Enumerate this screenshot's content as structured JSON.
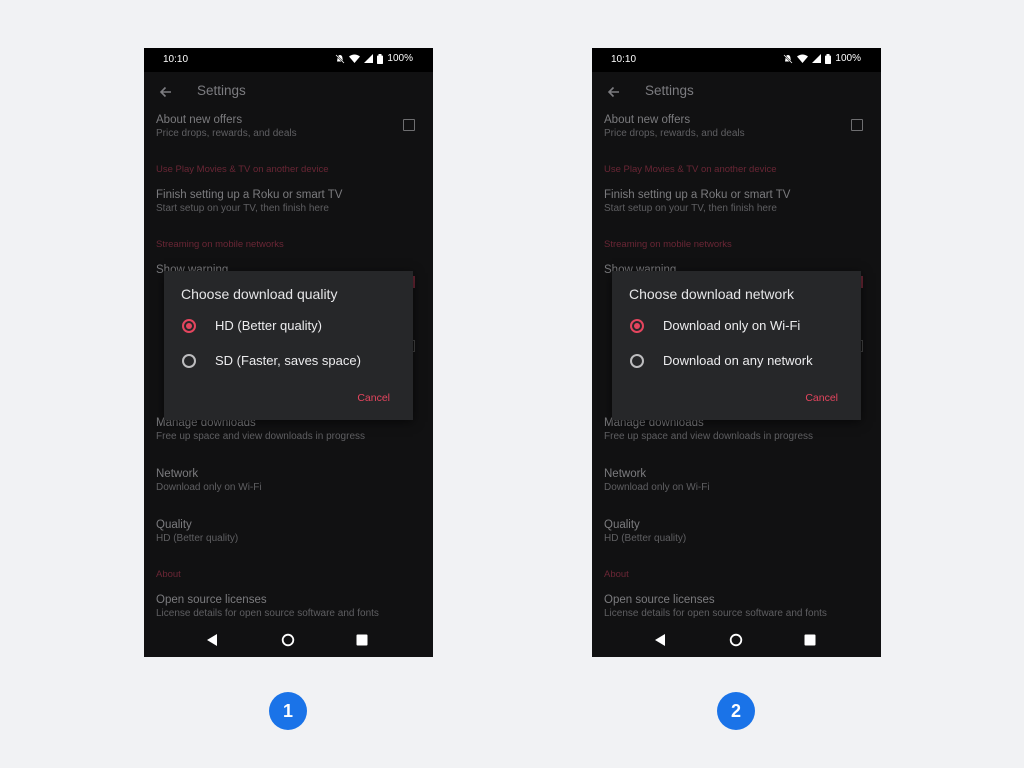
{
  "accent_color": "#e4455e",
  "badge_color": "#1a73e8",
  "screens": [
    {
      "status": {
        "time": "10:10",
        "battery": "100%"
      },
      "header": {
        "title": "Settings",
        "back_icon": "arrow-back-icon"
      },
      "settings": {
        "offers": {
          "title": "About new offers",
          "subtitle": "Price drops, rewards, and deals"
        },
        "section_device": "Use Play Movies & TV on another device",
        "roku": {
          "title": "Finish setting up a Roku or smart TV",
          "subtitle": "Start setup on your TV, then finish here"
        },
        "section_streaming": "Streaming on mobile networks",
        "show_warning": {
          "title": "Show warning"
        },
        "manage": {
          "title": "Manage downloads",
          "subtitle": "Free up space and view downloads in progress"
        },
        "network": {
          "title": "Network",
          "subtitle": "Download only on Wi-Fi"
        },
        "quality": {
          "title": "Quality",
          "subtitle": "HD (Better quality)"
        },
        "section_about": "About",
        "licenses": {
          "title": "Open source licenses",
          "subtitle": "License details for open source software and fonts"
        }
      },
      "dialog": {
        "title": "Choose download quality",
        "options": [
          {
            "label": "HD (Better quality)",
            "selected": true
          },
          {
            "label": "SD (Faster, saves space)",
            "selected": false
          }
        ],
        "cancel": "Cancel"
      },
      "badge": "1"
    },
    {
      "status": {
        "time": "10:10",
        "battery": "100%"
      },
      "header": {
        "title": "Settings",
        "back_icon": "arrow-back-icon"
      },
      "settings": {
        "offers": {
          "title": "About new offers",
          "subtitle": "Price drops, rewards, and deals"
        },
        "section_device": "Use Play Movies & TV on another device",
        "roku": {
          "title": "Finish setting up a Roku or smart TV",
          "subtitle": "Start setup on your TV, then finish here"
        },
        "section_streaming": "Streaming on mobile networks",
        "show_warning": {
          "title": "Show warning"
        },
        "manage": {
          "title": "Manage downloads",
          "subtitle": "Free up space and view downloads in progress"
        },
        "network": {
          "title": "Network",
          "subtitle": "Download only on Wi-Fi"
        },
        "quality": {
          "title": "Quality",
          "subtitle": "HD (Better quality)"
        },
        "section_about": "About",
        "licenses": {
          "title": "Open source licenses",
          "subtitle": "License details for open source software and fonts"
        }
      },
      "dialog": {
        "title": "Choose download network",
        "options": [
          {
            "label": "Download only on Wi-Fi",
            "selected": true
          },
          {
            "label": "Download on any network",
            "selected": false
          }
        ],
        "cancel": "Cancel"
      },
      "badge": "2"
    }
  ]
}
